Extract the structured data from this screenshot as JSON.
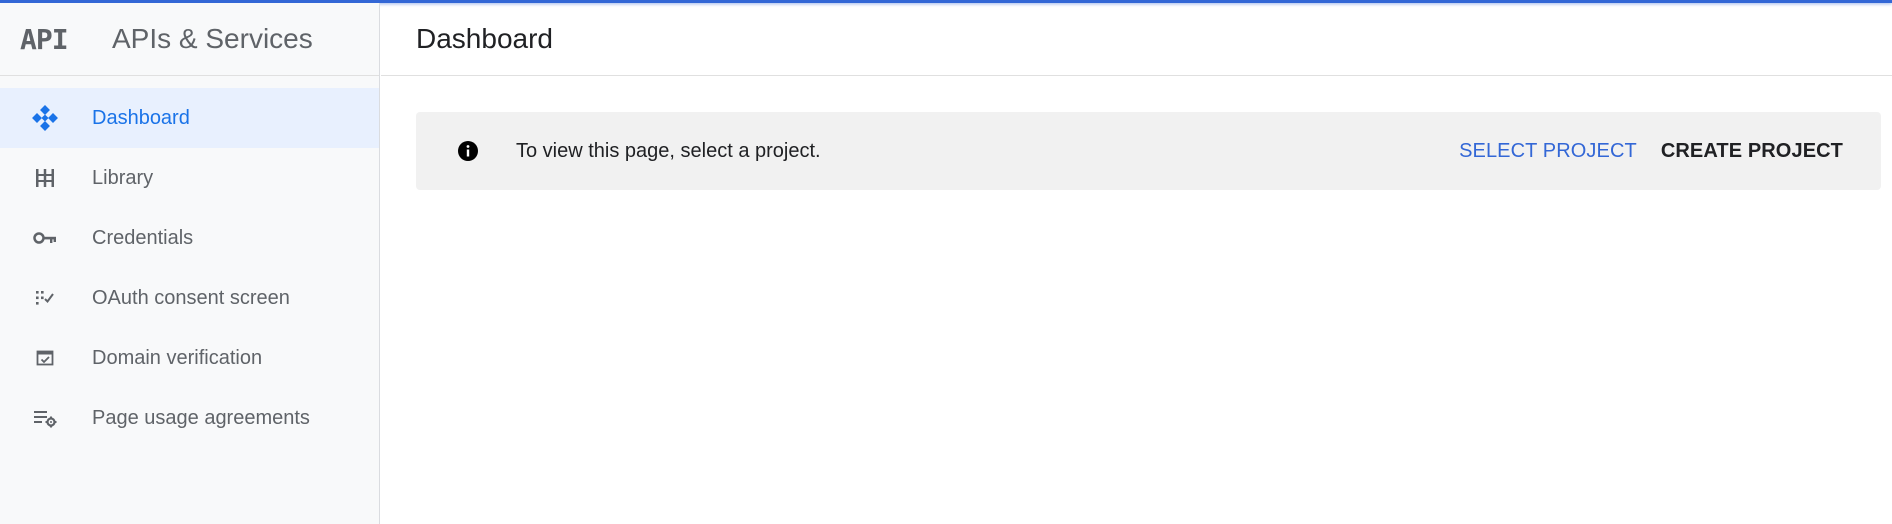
{
  "app": {
    "logo_text": "API",
    "title": "APIs & Services"
  },
  "sidebar": {
    "items": [
      {
        "label": "Dashboard",
        "icon": "dashboard-icon",
        "active": true
      },
      {
        "label": "Library",
        "icon": "library-icon",
        "active": false
      },
      {
        "label": "Credentials",
        "icon": "key-icon",
        "active": false
      },
      {
        "label": "OAuth consent screen",
        "icon": "oauth-consent-icon",
        "active": false
      },
      {
        "label": "Domain verification",
        "icon": "domain-verification-icon",
        "active": false
      },
      {
        "label": "Page usage agreements",
        "icon": "page-usage-agreements-icon",
        "active": false
      }
    ]
  },
  "main": {
    "title": "Dashboard",
    "banner": {
      "icon": "info-icon",
      "message": "To view this page, select a project.",
      "select_label": "SELECT PROJECT",
      "create_label": "CREATE PROJECT"
    }
  },
  "colors": {
    "accent": "#1a73e8",
    "link": "#3367d6",
    "active_bg": "#e8f0fe",
    "sidebar_bg": "#f8f9fa",
    "banner_bg": "#f1f1f1"
  }
}
